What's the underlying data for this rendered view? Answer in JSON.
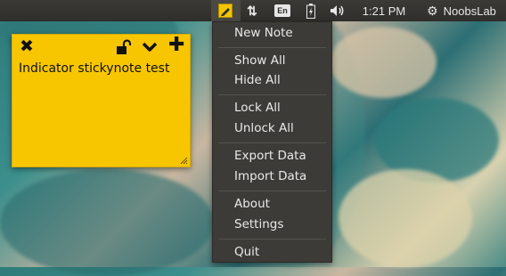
{
  "top_panel": {
    "indicators": {
      "stickynotes": {
        "icon": "sticky-note-pencil-icon",
        "accent": "#f2c500"
      },
      "network": {
        "icon": "network-updown-icon",
        "glyph": "⇅"
      },
      "keyboard": {
        "label": "En"
      },
      "battery": {
        "icon": "battery-charging-icon"
      },
      "volume": {
        "icon": "speaker-volume-icon",
        "glyph": "🔈"
      }
    },
    "clock": "1:21 PM",
    "session": {
      "icon": "gear-icon",
      "glyph": "⚙",
      "username": "NoobsLab"
    }
  },
  "sticky_note": {
    "text": "Indicator stickynote test",
    "color": "#f7c600",
    "toolbar": {
      "close": {
        "icon": "close-icon",
        "glyph": "✖"
      },
      "lock": {
        "icon": "lock-open-icon"
      },
      "collapse": {
        "icon": "chevron-down-icon"
      },
      "add": {
        "icon": "plus-icon",
        "glyph": "✚"
      }
    }
  },
  "menu": {
    "groups": [
      {
        "items": [
          {
            "label": "New Note"
          }
        ]
      },
      {
        "items": [
          {
            "label": "Show All"
          },
          {
            "label": "Hide All"
          }
        ]
      },
      {
        "items": [
          {
            "label": "Lock All"
          },
          {
            "label": "Unlock All"
          }
        ]
      },
      {
        "items": [
          {
            "label": "Export Data"
          },
          {
            "label": "Import Data"
          }
        ]
      },
      {
        "items": [
          {
            "label": "About"
          },
          {
            "label": "Settings"
          }
        ]
      },
      {
        "items": [
          {
            "label": "Quit"
          }
        ]
      }
    ]
  }
}
